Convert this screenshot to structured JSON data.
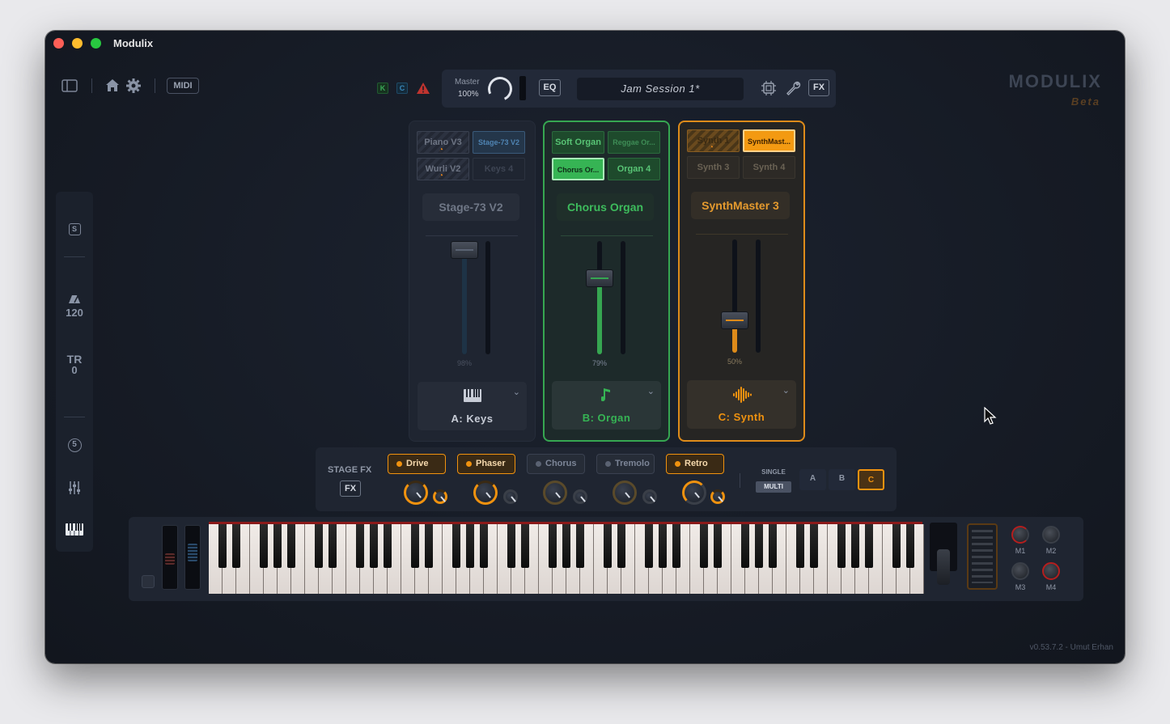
{
  "window": {
    "title": "Modulix"
  },
  "toolbar": {
    "midi_label": "MIDI",
    "badge_k": "K",
    "badge_c": "C",
    "warning_icon": "warning-icon",
    "master_label": "Master",
    "master_value": "100%",
    "eq_label": "EQ",
    "session_name": "Jam Session 1*",
    "fx_label": "FX"
  },
  "brand": {
    "name": "MODULIX",
    "sub": "Beta"
  },
  "sidebar": {
    "s_label": "S",
    "tempo": "120",
    "tr_label": "TR",
    "tr_value": "0",
    "five_label": "5"
  },
  "channels": {
    "a": {
      "presets": [
        "Piano V3",
        "Stage-73 V2",
        "Wurli V2",
        "Keys 4"
      ],
      "name": "Stage-73 V2",
      "level": "98%",
      "level_value": 0.98,
      "label": "A: Keys",
      "color": "#3e6a8f"
    },
    "b": {
      "presets": [
        "Soft Organ",
        "Reggae Or...",
        "Chorus Or...",
        "Organ 4"
      ],
      "name": "Chorus Organ",
      "level": "79%",
      "level_value": 0.79,
      "label": "B: Organ",
      "color": "#36a651"
    },
    "c": {
      "presets": [
        "Synth 1",
        "SynthMast...",
        "Synth 3",
        "Synth 4"
      ],
      "name": "SynthMaster 3",
      "level": "50%",
      "level_value": 0.5,
      "label": "C: Synth",
      "color": "#de8b1a"
    }
  },
  "stage_fx": {
    "label": "STAGE FX",
    "fx_button": "FX",
    "effects": [
      {
        "name": "Drive",
        "on": true
      },
      {
        "name": "Phaser",
        "on": true
      },
      {
        "name": "Chorus",
        "on": false
      },
      {
        "name": "Tremolo",
        "on": false
      },
      {
        "name": "Retro",
        "on": true
      }
    ],
    "mode_single": "SINGLE",
    "mode_multi": "MULTI",
    "targets": [
      "A",
      "B",
      "C"
    ],
    "active_target": "C"
  },
  "keyboard": {
    "macros": [
      "M1",
      "M2",
      "M3",
      "M4"
    ]
  },
  "footer": {
    "version": "v0.53.7.2 - Umut Erhan"
  }
}
